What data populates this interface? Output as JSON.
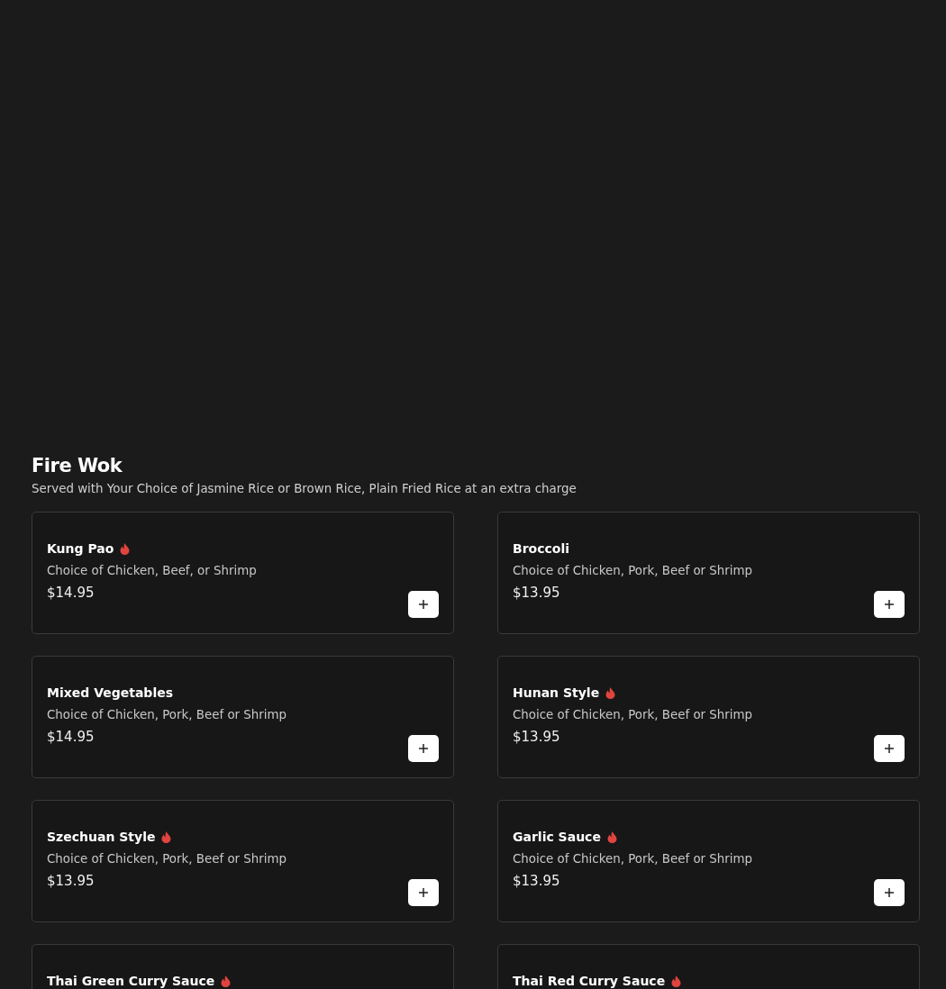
{
  "section": {
    "title": "Fire Wok",
    "subtitle": "Served with Your Choice of Jasmine Rice or Brown Rice, Plain Fried Rice at an extra charge"
  },
  "items": [
    {
      "name": "Kung Pao",
      "spicy": true,
      "description": "Choice of Chicken, Beef, or Shrimp",
      "price": "$14.95"
    },
    {
      "name": "Broccoli",
      "spicy": false,
      "description": "Choice of Chicken, Pork, Beef or Shrimp",
      "price": "$13.95"
    },
    {
      "name": "Mixed Vegetables",
      "spicy": false,
      "description": "Choice of Chicken, Pork, Beef or Shrimp",
      "price": "$14.95"
    },
    {
      "name": "Hunan Style",
      "spicy": true,
      "description": "Choice of Chicken, Pork, Beef or Shrimp",
      "price": "$13.95"
    },
    {
      "name": "Szechuan Style",
      "spicy": true,
      "description": "Choice of Chicken, Pork, Beef or Shrimp",
      "price": "$13.95"
    },
    {
      "name": "Garlic Sauce",
      "spicy": true,
      "description": "Choice of Chicken, Pork, Beef or Shrimp",
      "price": "$13.95"
    },
    {
      "name": "Thai Green Curry Sauce",
      "spicy": true
    },
    {
      "name": "Thai Red Curry Sauce",
      "spicy": true
    }
  ]
}
